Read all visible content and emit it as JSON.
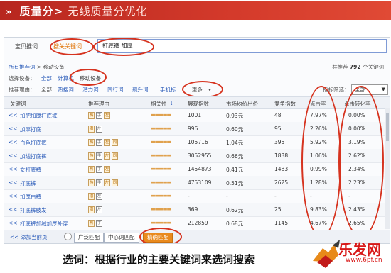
{
  "banner": {
    "arrows": "»",
    "title": "质量分>",
    "subtitle": "无线质量分优化"
  },
  "tabs": [
    "宝贝推词",
    "搜关关键词"
  ],
  "search": {
    "value": "打底裤 加厚"
  },
  "breadcrumb": {
    "prefix": "所有推荐词",
    "sep": ">",
    "current": "移动设备"
  },
  "total": {
    "prefix": "共推荐",
    "count": "792",
    "suffix": "个关键词"
  },
  "device": {
    "label": "选择设备：",
    "options": [
      "全部",
      "计算机",
      "移动设备"
    ]
  },
  "reason": {
    "label": "推荐理由：",
    "options": [
      "全部",
      "热搜词",
      "潜力词",
      "同行词",
      "飙升词",
      "手机标"
    ],
    "more": "更多"
  },
  "filter": {
    "label": "指标筛选：",
    "value": "全部"
  },
  "table": {
    "headers": [
      "关键词",
      "推荐理由",
      "相关性",
      "展现指数",
      "市场均价出价",
      "竞争指数",
      "点击率",
      "点击转化率"
    ],
    "rows": [
      {
        "kw": "加肥加厚打底裤",
        "tags": [
          "热",
          "手",
          "左"
        ],
        "stars": "▬▬▬▬▬",
        "imp": "1001",
        "price": "0.93元",
        "comp": "48",
        "ctr": "7.97%",
        "cvr": "0.00%"
      },
      {
        "kw": "加厚打底",
        "tags": [
          "潜",
          "左"
        ],
        "stars": "▬▬▬▬▬",
        "imp": "996",
        "price": "0.60元",
        "comp": "95",
        "ctr": "2.26%",
        "cvr": "0.00%"
      },
      {
        "kw": "白色打底裤",
        "tags": [
          "热",
          "手",
          "左",
          "同"
        ],
        "stars": "▬▬▬▬▬",
        "imp": "105716",
        "price": "1.04元",
        "comp": "395",
        "ctr": "5.92%",
        "cvr": "3.19%"
      },
      {
        "kw": "加绒打底裤",
        "tags": [
          "热",
          "手",
          "左",
          "同"
        ],
        "stars": "▬▬▬▬▬",
        "imp": "3052955",
        "price": "0.66元",
        "comp": "1838",
        "ctr": "1.06%",
        "cvr": "2.62%"
      },
      {
        "kw": "女打底裤",
        "tags": [
          "热",
          "手",
          "左"
        ],
        "stars": "▬▬▬▬▬",
        "imp": "1454873",
        "price": "0.41元",
        "comp": "1483",
        "ctr": "0.99%",
        "cvr": "2.34%"
      },
      {
        "kw": "打底裤",
        "tags": [
          "热",
          "手",
          "左",
          "同"
        ],
        "stars": "▬▬▬▬▬",
        "imp": "4753109",
        "price": "0.51元",
        "comp": "2625",
        "ctr": "1.28%",
        "cvr": "2.23%"
      },
      {
        "kw": "加厚白裤",
        "tags": [
          "潜",
          "左"
        ],
        "stars": "▬▬▬▬▬",
        "imp": "-",
        "price": "-",
        "comp": "-",
        "ctr": "-",
        "cvr": "-"
      },
      {
        "kw": "打底裤肢发",
        "tags": [
          "潜",
          "左"
        ],
        "stars": "▬▬▬▬▬",
        "imp": "369",
        "price": "0.62元",
        "comp": "25",
        "ctr": "9.83%",
        "cvr": "2.43%"
      },
      {
        "kw": "打底裤加绒加厚外穿",
        "tags": [
          "热",
          "手"
        ],
        "stars": "▬▬▬▬▬",
        "imp": "212859",
        "price": "0.68元",
        "comp": "1145",
        "ctr": "4.67%",
        "cvr": "2.65%"
      }
    ]
  },
  "footer": {
    "add": "添加当前页",
    "buttons": [
      "广泛匹配",
      "中心词匹配",
      "精确匹配"
    ]
  },
  "caption": "选词：根据行业的主要关键词来选词搜索",
  "logo": {
    "brand": "乐发网",
    "url": "www.6pf.cn"
  },
  "colors": {
    "accent_red": "#d6331f",
    "link_blue": "#2a5bb9",
    "banner": "#c62f22"
  }
}
